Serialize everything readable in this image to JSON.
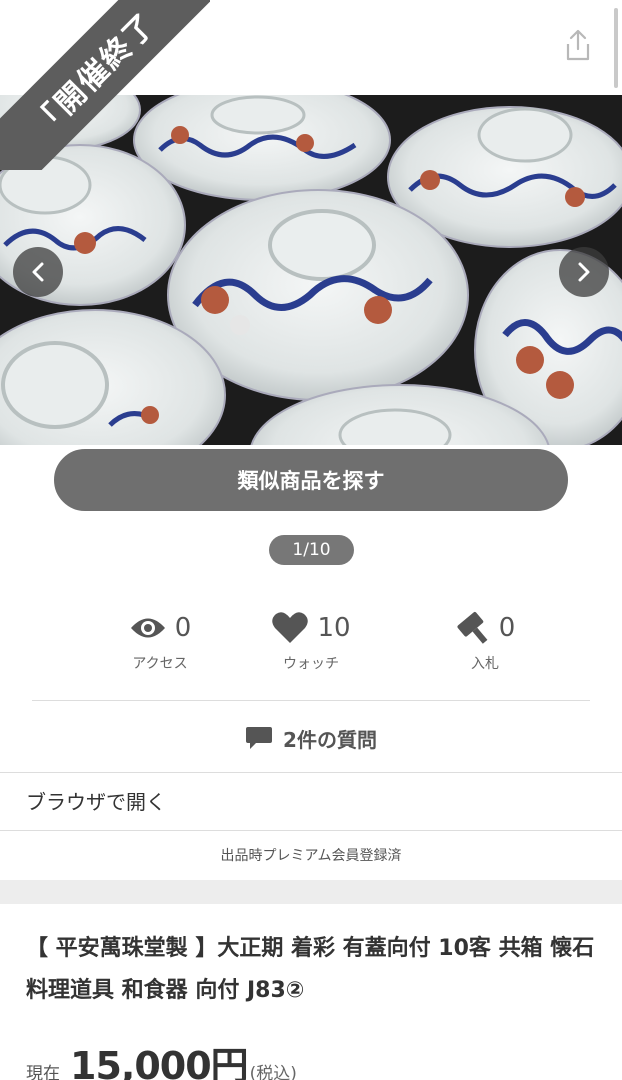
{
  "ribbon": {
    "text": "「開催終了"
  },
  "gallery": {
    "image_alt": "covered bowls with blue-and-red flower pattern",
    "page_counter": "1/10"
  },
  "actions": {
    "similar_label": "類似商品を探す"
  },
  "stats": {
    "access": {
      "value": "0",
      "label": "アクセス",
      "icon": "eye-icon"
    },
    "watch": {
      "value": "10",
      "label": "ウォッチ",
      "icon": "heart-icon"
    },
    "bids": {
      "value": "0",
      "label": "入札",
      "icon": "gavel-icon"
    }
  },
  "questions": {
    "label": "2件の質問",
    "icon": "speech-bubble-icon"
  },
  "links": {
    "open_browser": "ブラウザで開く"
  },
  "seller_note": "出品時プレミアム会員登録済",
  "item": {
    "title": "【 平安萬珠堂製 】大正期 着彩 有蓋向付 10客 共箱 懐石料理道具 和食器 向付 J83②",
    "price_label": "現在",
    "price": "15,000円",
    "tax": "(税込)"
  },
  "colors": {
    "ribbon": "#5d5d5d",
    "button": "#6f6f6f",
    "counter": "#777777"
  }
}
